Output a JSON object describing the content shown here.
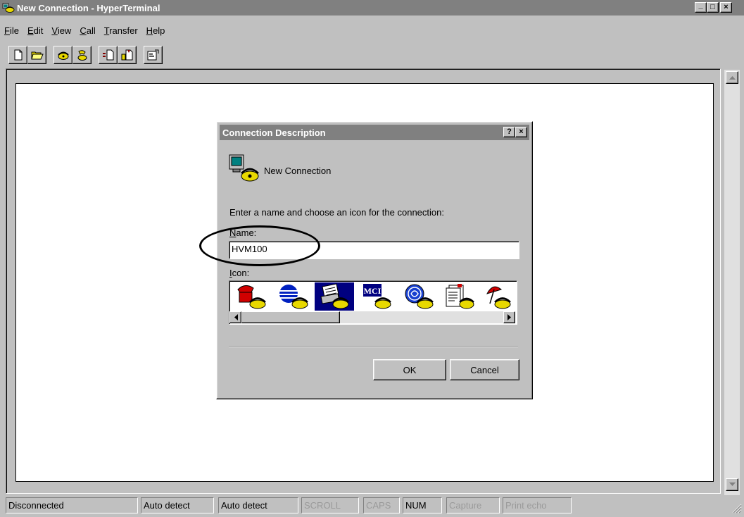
{
  "window": {
    "title": "New Connection - HyperTerminal",
    "minimize": "_",
    "maximize": "□",
    "close": "×"
  },
  "menu": [
    {
      "label": "File",
      "underline": "F",
      "rest": "ile"
    },
    {
      "label": "Edit",
      "underline": "E",
      "rest": "dit"
    },
    {
      "label": "View",
      "underline": "V",
      "rest": "iew"
    },
    {
      "label": "Call",
      "underline": "C",
      "rest": "all"
    },
    {
      "label": "Transfer",
      "underline": "T",
      "rest": "ransfer"
    },
    {
      "label": "Help",
      "underline": "H",
      "rest": "elp"
    }
  ],
  "toolbar": {
    "icons": [
      "new-icon",
      "open-icon",
      "connect-icon",
      "disconnect-icon",
      "send-icon",
      "receive-icon",
      "properties-icon"
    ]
  },
  "dialog": {
    "title": "Connection Description",
    "help": "?",
    "close": "×",
    "connection_name": "New Connection",
    "instruction": "Enter a name and choose an icon for the connection:",
    "name_label_u": "N",
    "name_label_rest": "ame:",
    "name_value": "HVM100",
    "icon_label_u": "I",
    "icon_label_rest": "con:",
    "icons": [
      "red-phone-icon",
      "globe-phone-icon",
      "fax-phone-icon",
      "mci-phone-icon",
      "ge-phone-icon",
      "document-phone-icon",
      "umbrella-phone-icon"
    ],
    "selected_icon_index": 2,
    "mci_text": "MCI",
    "ok": "OK",
    "cancel": "Cancel"
  },
  "statusbar": {
    "connection": "Disconnected",
    "detect1": "Auto detect",
    "detect2": "Auto detect",
    "scroll": "SCROLL",
    "caps": "CAPS",
    "num": "NUM",
    "capture": "Capture",
    "print_echo": "Print echo"
  },
  "colors": {
    "face": "#c0c0c0",
    "titlebar_inactive": "#808080",
    "selection": "#000080",
    "phone_yellow": "#e8d800"
  }
}
